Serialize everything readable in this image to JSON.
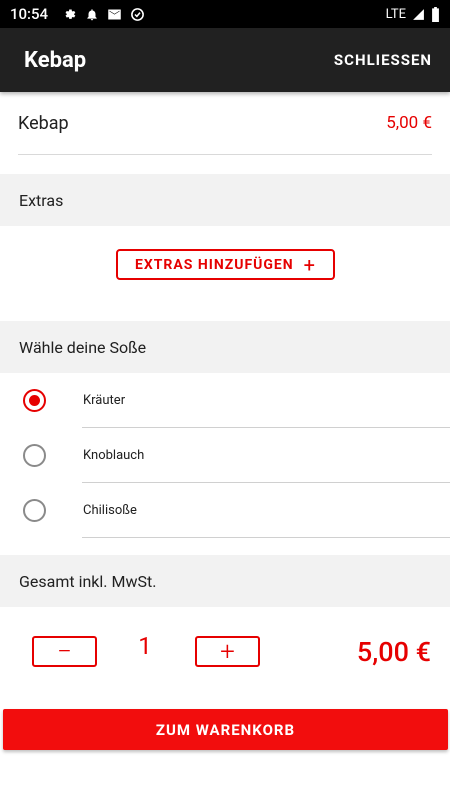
{
  "status_bar": {
    "time": "10:54",
    "network": "LTE"
  },
  "app_bar": {
    "title": "Kebap",
    "close_label": "SCHLIESSEN"
  },
  "product": {
    "name": "Kebap",
    "price": "5,00 €"
  },
  "extras": {
    "header": "Extras",
    "add_button_label": "EXTRAS HINZUFÜGEN",
    "add_button_icon": "+"
  },
  "sauce": {
    "header": "Wähle deine Soße",
    "options": [
      {
        "label": "Kräuter",
        "selected": true
      },
      {
        "label": "Knoblauch",
        "selected": false
      },
      {
        "label": "Chilisoße",
        "selected": false
      }
    ]
  },
  "total": {
    "header": "Gesamt inkl. MwSt.",
    "decrement_label": "−",
    "increment_label": "+",
    "quantity": "1",
    "price": "5,00 €"
  },
  "cart_button": {
    "label": "ZUM WARENKORB"
  },
  "colors": {
    "accent": "#e60000",
    "app_bar": "#212121",
    "section_bg": "#f2f2f2"
  }
}
